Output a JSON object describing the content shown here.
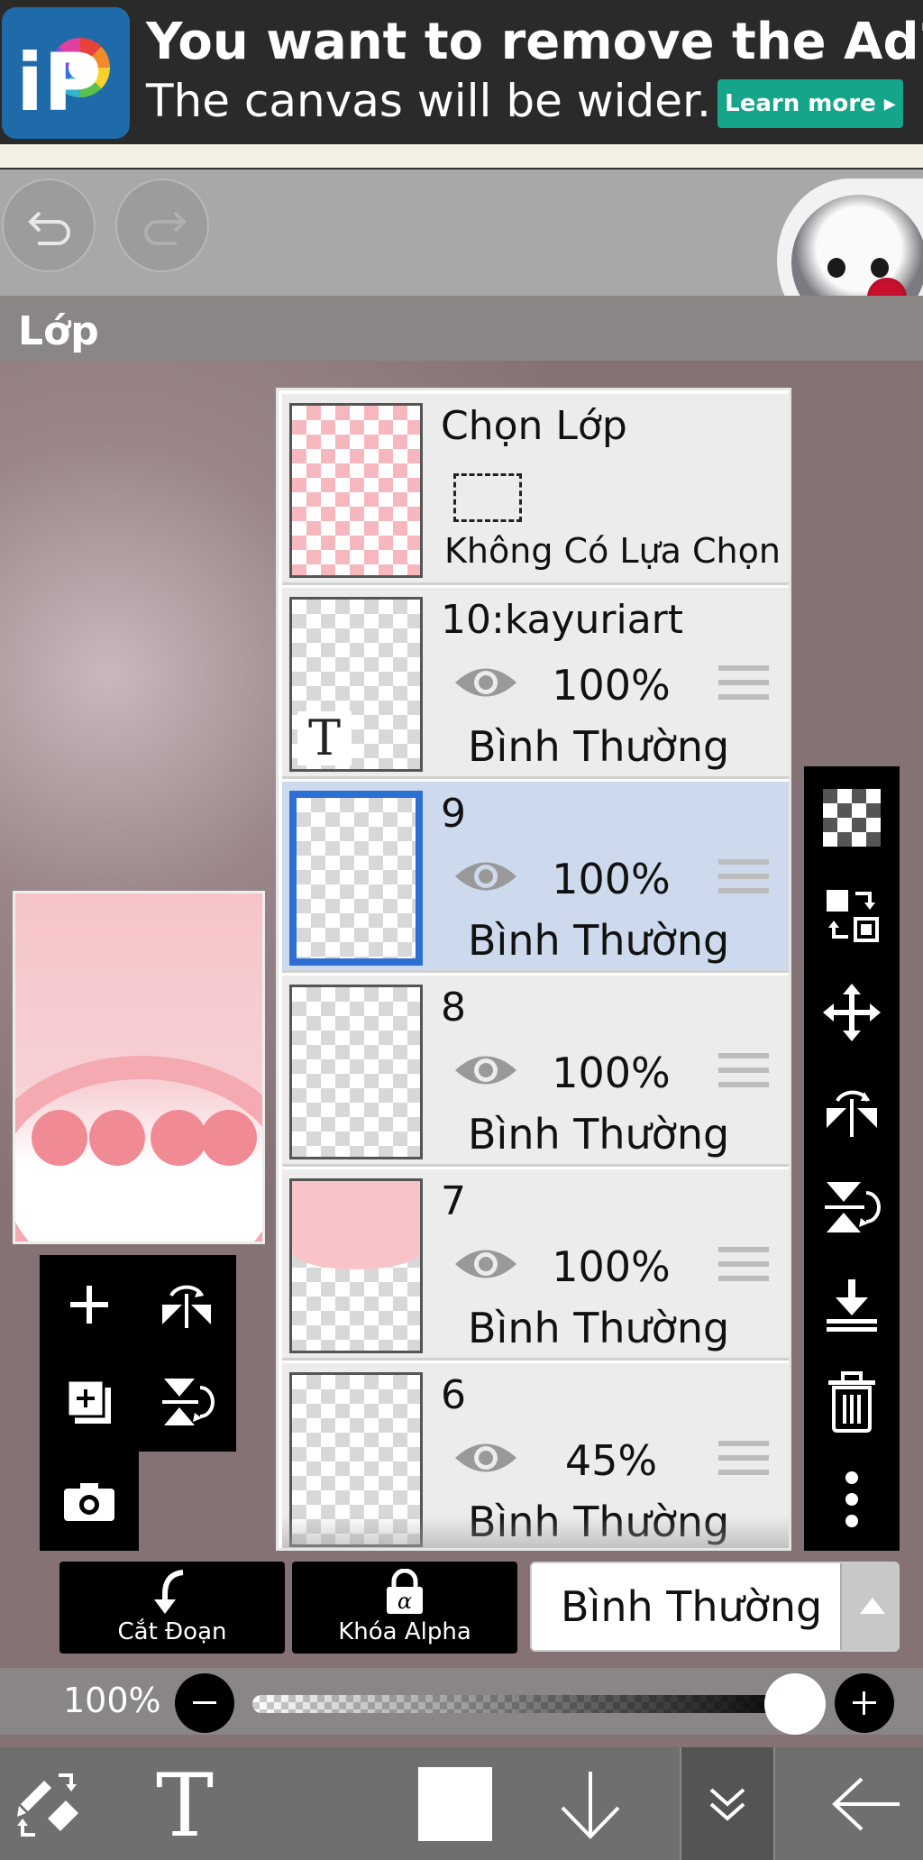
{
  "ad": {
    "title": "You want to remove the Ad?",
    "subtitle": "The canvas will be wider.",
    "learn_more": "Learn more ▸",
    "logo_text": "iP"
  },
  "panel": {
    "title": "Lớp"
  },
  "selection_row": {
    "title": "Chọn Lớp",
    "status": "Không Có Lựa Chọn"
  },
  "layers": [
    {
      "name": "10:kayuriart",
      "opacity": "100%",
      "blend": "Bình Thường",
      "text_layer_icon": "T",
      "selected": false
    },
    {
      "name": "9",
      "opacity": "100%",
      "blend": "Bình Thường",
      "selected": true
    },
    {
      "name": "8",
      "opacity": "100%",
      "blend": "Bình Thường",
      "selected": false
    },
    {
      "name": "7",
      "opacity": "100%",
      "blend": "Bình Thường",
      "selected": false
    },
    {
      "name": "6",
      "opacity": "45%",
      "blend": "Bình Thường",
      "selected": false
    }
  ],
  "bottom_controls": {
    "clipping_label": "Cắt Đoạn",
    "alpha_lock_label": "Khóa Alpha",
    "blend_mode_value": "Bình Thường"
  },
  "opacity_slider": {
    "label": "100%",
    "value": 1.0
  },
  "toolbar": {
    "active_item": "layers-toggle"
  },
  "colors": {
    "accent": "#2e6fd4",
    "selected_row": "#cdd9ec",
    "ad_button": "#14a58a",
    "current_color": "#ffffff"
  }
}
